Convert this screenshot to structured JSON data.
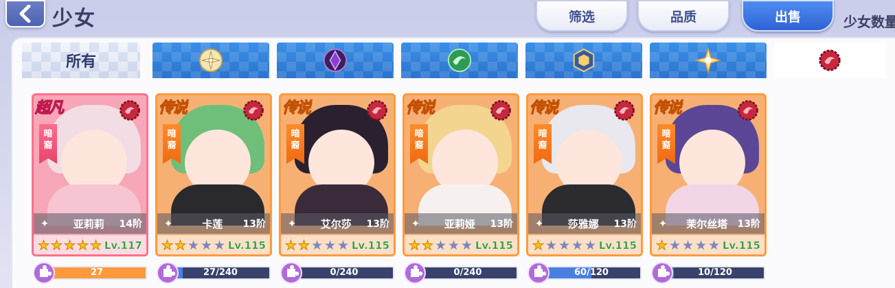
{
  "header": {
    "title": "少女",
    "filter_label": "筛选",
    "quality_label": "品质",
    "sell_label": "出售",
    "count_label": "少女数量"
  },
  "tabs": [
    {
      "label": "所有",
      "icon": "all",
      "active": false
    },
    {
      "label": "",
      "icon": "light-element-icon",
      "active": false
    },
    {
      "label": "",
      "icon": "dark-purple-element-icon",
      "active": false
    },
    {
      "label": "",
      "icon": "wind-element-icon",
      "active": false
    },
    {
      "label": "",
      "icon": "earth-element-icon",
      "active": false
    },
    {
      "label": "",
      "icon": "star-element-icon",
      "active": false
    },
    {
      "label": "",
      "icon": "blood-element-icon",
      "active": true
    }
  ],
  "cards": [
    {
      "rarity": "超凡",
      "type_line1": "暗",
      "type_line2": "裔",
      "name": "亚莉莉",
      "rank": "14阶",
      "stars": 5,
      "level": "Lv.117",
      "shard_text": "27",
      "shard_progress": 1.0,
      "class_icon": "feather-class-icon"
    },
    {
      "rarity": "传说",
      "type_line1": "暗",
      "type_line2": "裔",
      "name": "卡莲",
      "rank": "13阶",
      "stars": 2,
      "level": "Lv.115",
      "shard_text": "27/240",
      "shard_progress": 0.11,
      "class_icon": "wings-class-icon"
    },
    {
      "rarity": "传说",
      "type_line1": "暗",
      "type_line2": "裔",
      "name": "艾尔莎",
      "rank": "13阶",
      "stars": 2,
      "level": "Lv.115",
      "shard_text": "0/240",
      "shard_progress": 0.0,
      "class_icon": "shield-class-icon"
    },
    {
      "rarity": "传说",
      "type_line1": "暗",
      "type_line2": "裔",
      "name": "亚莉娅",
      "rank": "13阶",
      "stars": 2,
      "level": "Lv.115",
      "shard_text": "0/240",
      "shard_progress": 0.0,
      "class_icon": "wings-class-icon"
    },
    {
      "rarity": "传说",
      "type_line1": "暗",
      "type_line2": "裔",
      "name": "莎雅娜",
      "rank": "13阶",
      "stars": 1,
      "level": "Lv.115",
      "shard_text": "60/120",
      "shard_progress": 0.5,
      "class_icon": "feather-class-icon"
    },
    {
      "rarity": "传说",
      "type_line1": "暗",
      "type_line2": "裔",
      "name": "茉尔丝塔",
      "rank": "13阶",
      "stars": 1,
      "level": "Lv.115",
      "shard_text": "10/120",
      "shard_progress": 0.083,
      "class_icon": "snowflake-class-icon"
    }
  ],
  "colors": {
    "accent_blue": "#2f62d6",
    "legend_orange": "#ff9a3c",
    "super_pink": "#ff6f8a",
    "shard_fill_orange": "#ff9a3c",
    "shard_fill_blue": "#4a7fe0"
  }
}
